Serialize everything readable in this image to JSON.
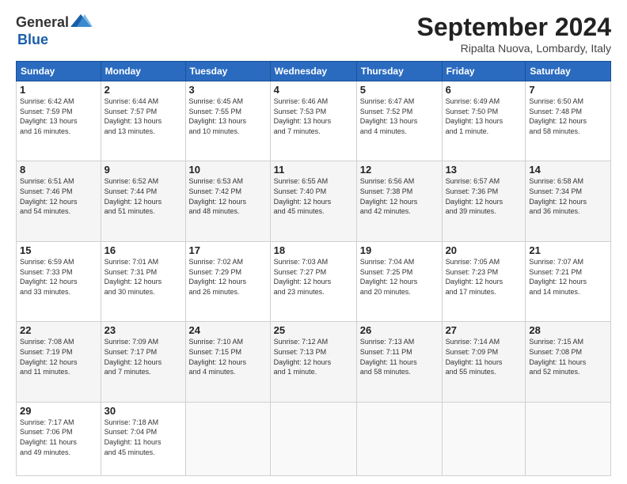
{
  "header": {
    "logo_general": "General",
    "logo_blue": "Blue",
    "month_title": "September 2024",
    "location": "Ripalta Nuova, Lombardy, Italy"
  },
  "days_of_week": [
    "Sunday",
    "Monday",
    "Tuesday",
    "Wednesday",
    "Thursday",
    "Friday",
    "Saturday"
  ],
  "weeks": [
    [
      {
        "day": 1,
        "info": "Sunrise: 6:42 AM\nSunset: 7:59 PM\nDaylight: 13 hours\nand 16 minutes."
      },
      {
        "day": 2,
        "info": "Sunrise: 6:44 AM\nSunset: 7:57 PM\nDaylight: 13 hours\nand 13 minutes."
      },
      {
        "day": 3,
        "info": "Sunrise: 6:45 AM\nSunset: 7:55 PM\nDaylight: 13 hours\nand 10 minutes."
      },
      {
        "day": 4,
        "info": "Sunrise: 6:46 AM\nSunset: 7:53 PM\nDaylight: 13 hours\nand 7 minutes."
      },
      {
        "day": 5,
        "info": "Sunrise: 6:47 AM\nSunset: 7:52 PM\nDaylight: 13 hours\nand 4 minutes."
      },
      {
        "day": 6,
        "info": "Sunrise: 6:49 AM\nSunset: 7:50 PM\nDaylight: 13 hours\nand 1 minute."
      },
      {
        "day": 7,
        "info": "Sunrise: 6:50 AM\nSunset: 7:48 PM\nDaylight: 12 hours\nand 58 minutes."
      }
    ],
    [
      {
        "day": 8,
        "info": "Sunrise: 6:51 AM\nSunset: 7:46 PM\nDaylight: 12 hours\nand 54 minutes."
      },
      {
        "day": 9,
        "info": "Sunrise: 6:52 AM\nSunset: 7:44 PM\nDaylight: 12 hours\nand 51 minutes."
      },
      {
        "day": 10,
        "info": "Sunrise: 6:53 AM\nSunset: 7:42 PM\nDaylight: 12 hours\nand 48 minutes."
      },
      {
        "day": 11,
        "info": "Sunrise: 6:55 AM\nSunset: 7:40 PM\nDaylight: 12 hours\nand 45 minutes."
      },
      {
        "day": 12,
        "info": "Sunrise: 6:56 AM\nSunset: 7:38 PM\nDaylight: 12 hours\nand 42 minutes."
      },
      {
        "day": 13,
        "info": "Sunrise: 6:57 AM\nSunset: 7:36 PM\nDaylight: 12 hours\nand 39 minutes."
      },
      {
        "day": 14,
        "info": "Sunrise: 6:58 AM\nSunset: 7:34 PM\nDaylight: 12 hours\nand 36 minutes."
      }
    ],
    [
      {
        "day": 15,
        "info": "Sunrise: 6:59 AM\nSunset: 7:33 PM\nDaylight: 12 hours\nand 33 minutes."
      },
      {
        "day": 16,
        "info": "Sunrise: 7:01 AM\nSunset: 7:31 PM\nDaylight: 12 hours\nand 30 minutes."
      },
      {
        "day": 17,
        "info": "Sunrise: 7:02 AM\nSunset: 7:29 PM\nDaylight: 12 hours\nand 26 minutes."
      },
      {
        "day": 18,
        "info": "Sunrise: 7:03 AM\nSunset: 7:27 PM\nDaylight: 12 hours\nand 23 minutes."
      },
      {
        "day": 19,
        "info": "Sunrise: 7:04 AM\nSunset: 7:25 PM\nDaylight: 12 hours\nand 20 minutes."
      },
      {
        "day": 20,
        "info": "Sunrise: 7:05 AM\nSunset: 7:23 PM\nDaylight: 12 hours\nand 17 minutes."
      },
      {
        "day": 21,
        "info": "Sunrise: 7:07 AM\nSunset: 7:21 PM\nDaylight: 12 hours\nand 14 minutes."
      }
    ],
    [
      {
        "day": 22,
        "info": "Sunrise: 7:08 AM\nSunset: 7:19 PM\nDaylight: 12 hours\nand 11 minutes."
      },
      {
        "day": 23,
        "info": "Sunrise: 7:09 AM\nSunset: 7:17 PM\nDaylight: 12 hours\nand 7 minutes."
      },
      {
        "day": 24,
        "info": "Sunrise: 7:10 AM\nSunset: 7:15 PM\nDaylight: 12 hours\nand 4 minutes."
      },
      {
        "day": 25,
        "info": "Sunrise: 7:12 AM\nSunset: 7:13 PM\nDaylight: 12 hours\nand 1 minute."
      },
      {
        "day": 26,
        "info": "Sunrise: 7:13 AM\nSunset: 7:11 PM\nDaylight: 11 hours\nand 58 minutes."
      },
      {
        "day": 27,
        "info": "Sunrise: 7:14 AM\nSunset: 7:09 PM\nDaylight: 11 hours\nand 55 minutes."
      },
      {
        "day": 28,
        "info": "Sunrise: 7:15 AM\nSunset: 7:08 PM\nDaylight: 11 hours\nand 52 minutes."
      }
    ],
    [
      {
        "day": 29,
        "info": "Sunrise: 7:17 AM\nSunset: 7:06 PM\nDaylight: 11 hours\nand 49 minutes."
      },
      {
        "day": 30,
        "info": "Sunrise: 7:18 AM\nSunset: 7:04 PM\nDaylight: 11 hours\nand 45 minutes."
      },
      null,
      null,
      null,
      null,
      null
    ]
  ]
}
